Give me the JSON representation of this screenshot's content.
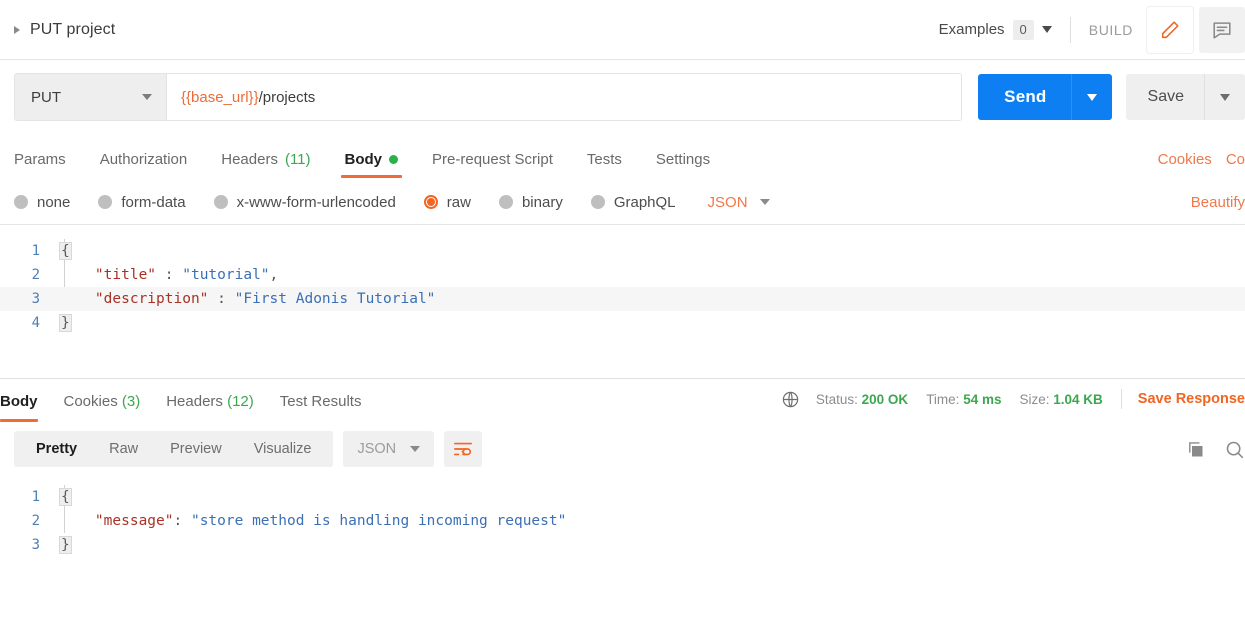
{
  "topbar": {
    "request_name": "PUT project",
    "expand_icon": "caret-right-icon",
    "examples_label": "Examples",
    "examples_count": "0",
    "build_label": "BUILD",
    "edit_icon": "pencil-icon",
    "comment_icon": "comment-icon"
  },
  "urlbar": {
    "method": "PUT",
    "url_variable": "{{base_url}}",
    "url_path": "/projects",
    "send_label": "Send",
    "save_label": "Save"
  },
  "request_tabs": {
    "items": [
      {
        "label": "Params",
        "active": false
      },
      {
        "label": "Authorization",
        "active": false
      },
      {
        "label": "Headers",
        "count": "(11)",
        "active": false
      },
      {
        "label": "Body",
        "active": true,
        "dot": true
      },
      {
        "label": "Pre-request Script",
        "active": false
      },
      {
        "label": "Tests",
        "active": false
      },
      {
        "label": "Settings",
        "active": false
      }
    ],
    "right_links": [
      "Cookies",
      "Co"
    ]
  },
  "body_type": {
    "options": [
      {
        "label": "none",
        "checked": false
      },
      {
        "label": "form-data",
        "checked": false
      },
      {
        "label": "x-www-form-urlencoded",
        "checked": false
      },
      {
        "label": "raw",
        "checked": true
      },
      {
        "label": "binary",
        "checked": false
      },
      {
        "label": "GraphQL",
        "checked": false
      }
    ],
    "format": "JSON",
    "beautify_label": "Beautify"
  },
  "request_body": {
    "lines": [
      {
        "no": "1",
        "tokens": [
          {
            "t": "{",
            "c": "brace"
          }
        ]
      },
      {
        "no": "2",
        "tokens": [
          {
            "t": "    ",
            "c": "plain"
          },
          {
            "t": "\"title\"",
            "c": "key"
          },
          {
            "t": " : ",
            "c": "punct"
          },
          {
            "t": "\"tutorial\"",
            "c": "str"
          },
          {
            "t": ",",
            "c": "punct"
          }
        ]
      },
      {
        "no": "3",
        "highlight": true,
        "tokens": [
          {
            "t": "    ",
            "c": "plain"
          },
          {
            "t": "\"description\"",
            "c": "key"
          },
          {
            "t": " : ",
            "c": "punct"
          },
          {
            "t": "\"First Adonis Tutorial\"",
            "c": "str"
          }
        ]
      },
      {
        "no": "4",
        "tokens": [
          {
            "t": "}",
            "c": "brace"
          }
        ]
      }
    ]
  },
  "response_tabs": {
    "items": [
      {
        "label": "Body",
        "active": true
      },
      {
        "label": "Cookies",
        "count": "(3)",
        "active": false
      },
      {
        "label": "Headers",
        "count": "(12)",
        "active": false
      },
      {
        "label": "Test Results",
        "active": false
      }
    ]
  },
  "response_meta": {
    "globe_icon": "globe-icon",
    "status_label": "Status:",
    "status_value": "200 OK",
    "time_label": "Time:",
    "time_value": "54 ms",
    "size_label": "Size:",
    "size_value": "1.04 KB",
    "save_response_label": "Save Response"
  },
  "response_toolbar": {
    "views": [
      {
        "label": "Pretty",
        "active": true
      },
      {
        "label": "Raw",
        "active": false
      },
      {
        "label": "Preview",
        "active": false
      },
      {
        "label": "Visualize",
        "active": false
      }
    ],
    "format": "JSON",
    "wrap_icon": "word-wrap-icon",
    "copy_icon": "copy-icon",
    "search_icon": "search-icon"
  },
  "response_body": {
    "lines": [
      {
        "no": "1",
        "tokens": [
          {
            "t": "{",
            "c": "brace"
          }
        ]
      },
      {
        "no": "2",
        "tokens": [
          {
            "t": "    ",
            "c": "plain"
          },
          {
            "t": "\"message\"",
            "c": "key"
          },
          {
            "t": ": ",
            "c": "punct"
          },
          {
            "t": "\"store method is handling incoming request\"",
            "c": "str"
          }
        ]
      },
      {
        "no": "3",
        "tokens": [
          {
            "t": "}",
            "c": "brace"
          }
        ]
      }
    ]
  },
  "colors": {
    "accent_orange": "#f26522",
    "send_blue": "#0d7ff2",
    "success_green": "#3da750",
    "key_red": "#a93226",
    "string_blue": "#3b6fb6"
  }
}
